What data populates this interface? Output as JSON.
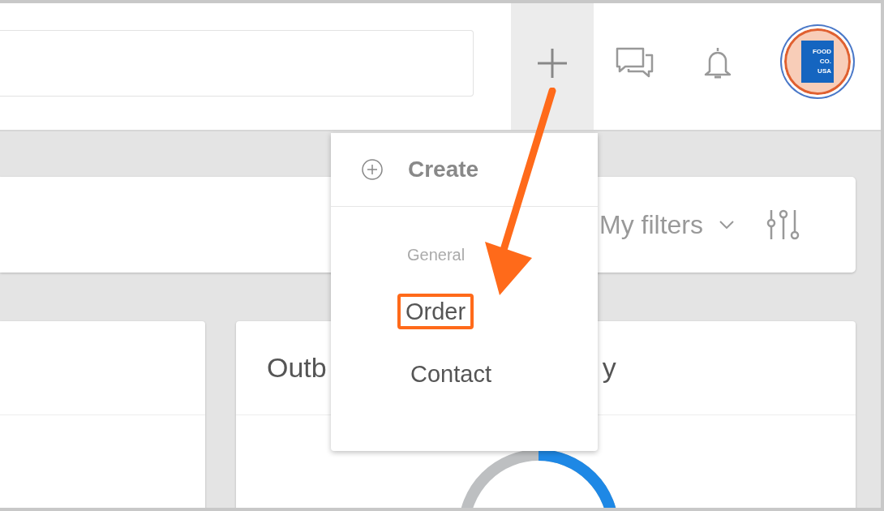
{
  "header": {
    "icons": [
      {
        "kind": "plus",
        "selected": true
      },
      {
        "kind": "chat",
        "selected": false
      },
      {
        "kind": "bell",
        "selected": false
      }
    ],
    "avatar": {
      "logo_lines": [
        "FOOD",
        "CO.",
        "USA"
      ]
    }
  },
  "filter_bar": {
    "label": "My filters"
  },
  "cards": [
    {
      "kind": "blank"
    },
    {
      "kind": "donut",
      "title_parts": [
        "Outb",
        "y"
      ]
    }
  ],
  "menu": {
    "title": "Create",
    "section": "General",
    "items": [
      {
        "label": "Order",
        "highlighted": true
      },
      {
        "label": "Contact",
        "highlighted": false
      }
    ]
  }
}
